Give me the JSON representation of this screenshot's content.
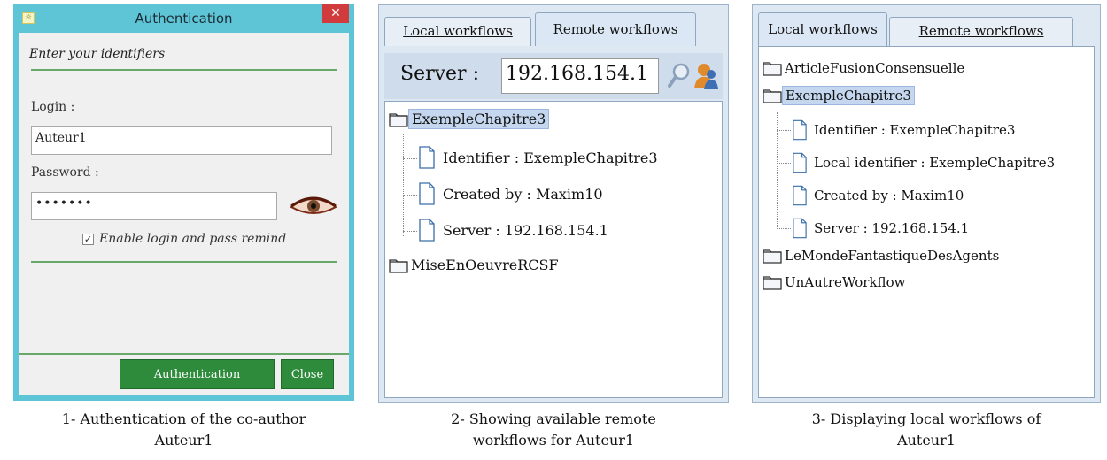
{
  "auth_window": {
    "title": "Authentication",
    "close_glyph": "✕",
    "subtitle": "Enter your identifiers",
    "login_label": "Login :",
    "login_value": "Auteur1",
    "password_label": "Password :",
    "password_mask": "•••••••",
    "remind_label": "Enable login and pass remind",
    "remind_checked": true,
    "auth_button": "Authentication",
    "close_button": "Close"
  },
  "remote_panel": {
    "tabs": [
      {
        "label": "Local workflows",
        "active": false
      },
      {
        "label": "Remote workflows",
        "active": true
      }
    ],
    "server_label": "Server :",
    "server_value": "192.168.154.1",
    "tree": [
      {
        "label": "ExempleChapitre3",
        "selected": true
      },
      {
        "label": "Identifier : ExempleChapitre3"
      },
      {
        "label": "Created by : Maxim10"
      },
      {
        "label": "Server : 192.168.154.1"
      },
      {
        "label": "MiseEnOeuvreRCSF"
      }
    ]
  },
  "local_panel": {
    "tabs": [
      {
        "label": "Local workflows",
        "active": true
      },
      {
        "label": "Remote workflows",
        "active": false
      }
    ],
    "tree": [
      {
        "label": "ArticleFusionConsensuelle"
      },
      {
        "label": "ExempleChapitre3",
        "selected": true
      },
      {
        "label": "Identifier : ExempleChapitre3"
      },
      {
        "label": "Local identifier : ExempleChapitre3"
      },
      {
        "label": "Created by : Maxim10"
      },
      {
        "label": "Server : 192.168.154.1"
      },
      {
        "label": "LeMondeFantastiqueDesAgents"
      },
      {
        "label": "UnAutreWorkflow"
      }
    ]
  },
  "captions": [
    "1- Authentication of the co-author\nAuteur1",
    "2- Showing available remote\nworkflows for Auteur1",
    "3- Displaying local workflows of\nAuteur1"
  ],
  "colors": {
    "window_frame": "#5ec5d6",
    "accent_green": "#2e8b3b",
    "close_red": "#d13b3b",
    "panel_bg": "#dde8f3",
    "selection": "#c4d7ef"
  },
  "icons": [
    "app-icon",
    "close-icon",
    "eye-icon",
    "checkbox-checked-icon",
    "search-icon",
    "user-icon",
    "folder-icon",
    "document-icon"
  ]
}
